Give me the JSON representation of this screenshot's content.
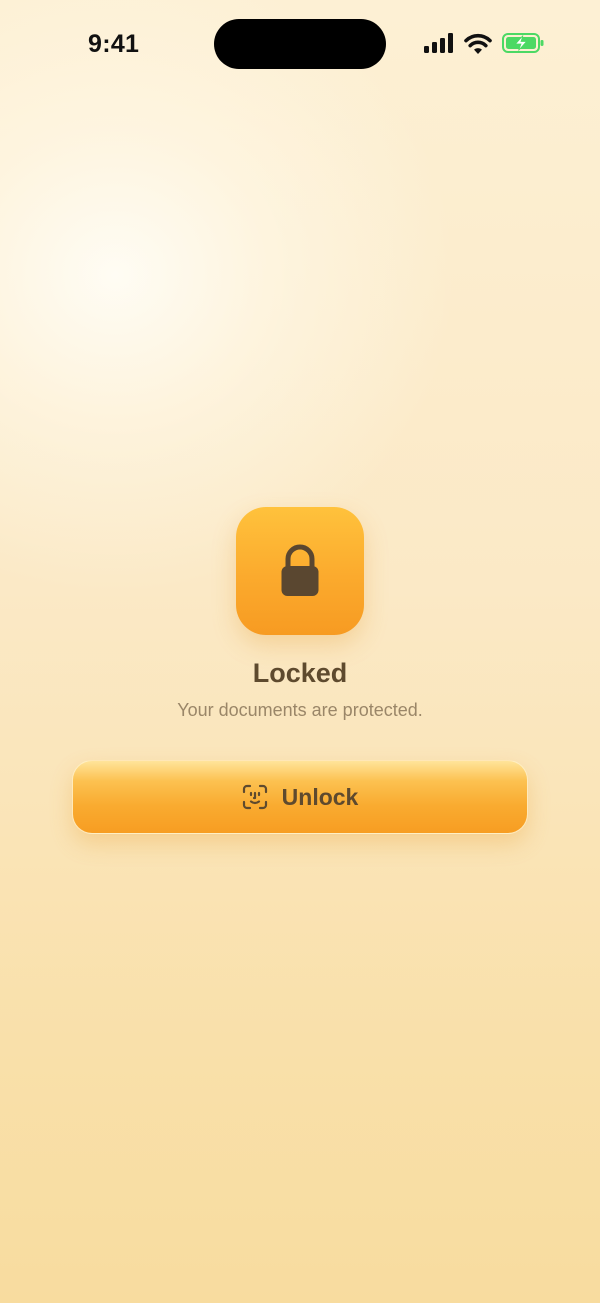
{
  "status_bar": {
    "time": "9:41",
    "icons": [
      "cellular-signal-icon",
      "wifi-icon",
      "battery-charging-icon"
    ],
    "battery_color": "#4cd964"
  },
  "lock_screen": {
    "icon": "lock-icon",
    "title": "Locked",
    "subtitle": "Your documents are protected."
  },
  "unlock_button": {
    "icon": "face-id-icon",
    "label": "Unlock"
  },
  "colors": {
    "accent": "#f9ab30",
    "accent_light": "#ffc23c",
    "text_primary": "#5e4a2e",
    "text_secondary": "#9a8668",
    "background": "#fbe9c6"
  }
}
